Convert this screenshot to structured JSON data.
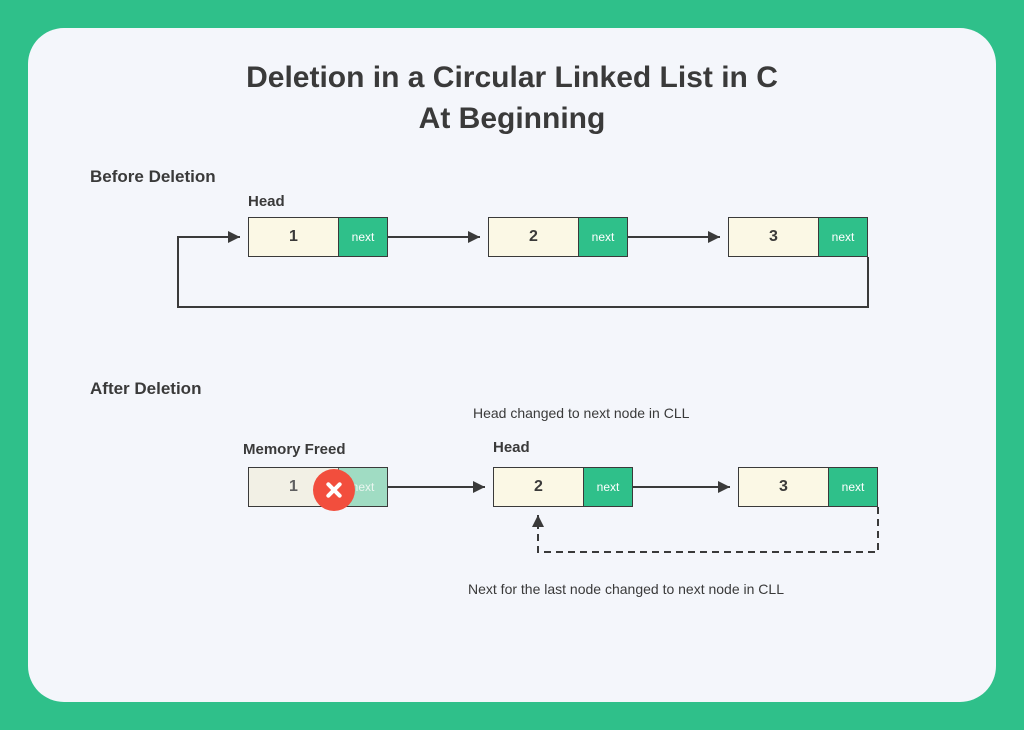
{
  "title_line1": "Deletion in a Circular Linked List in C",
  "title_line2": "At Beginning",
  "before": {
    "label": "Before Deletion",
    "head_label": "Head",
    "nodes": [
      {
        "value": "1",
        "next": "next"
      },
      {
        "value": "2",
        "next": "next"
      },
      {
        "value": "3",
        "next": "next"
      }
    ]
  },
  "after": {
    "label": "After Deletion",
    "memory_freed": "Memory Freed",
    "head_changed": "Head changed to next node in CLL",
    "head_label": "Head",
    "last_changed": "Next for the last node changed to next node in CLL",
    "nodes": [
      {
        "value": "1",
        "next": "next"
      },
      {
        "value": "2",
        "next": "next"
      },
      {
        "value": "3",
        "next": "next"
      }
    ]
  },
  "colors": {
    "accent": "#2fc08a",
    "node_fill": "#fbf8e5",
    "error": "#f24e3d",
    "text": "#3a3a3a"
  }
}
